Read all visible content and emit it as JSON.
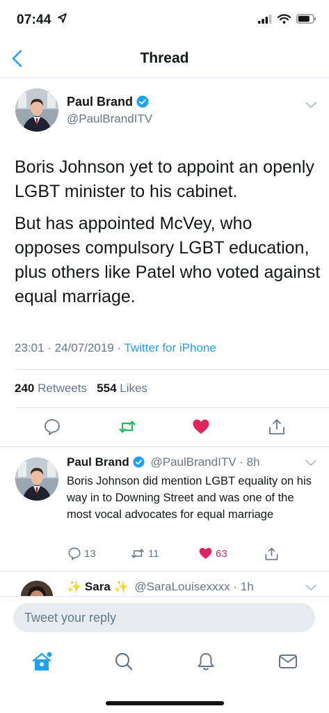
{
  "status_bar": {
    "time": "07:44"
  },
  "nav": {
    "title": "Thread"
  },
  "main_tweet": {
    "name": "Paul Brand",
    "handle": "@PaulBrandITV",
    "paragraphs": [
      "Boris Johnson yet to appoint an openly LGBT minister to his cabinet.",
      "But has appointed McVey, who opposes compulsory LGBT education, plus others like Patel who voted against equal marriage."
    ],
    "timestamp": "23:01 · 24/07/2019 · ",
    "source": "Twitter for iPhone",
    "retweets_count": "240",
    "retweets_label": "Retweets",
    "likes_count": "554",
    "likes_label": "Likes"
  },
  "reply_tweet": {
    "name": "Paul Brand",
    "handle_time": "@PaulBrandITV · 8h",
    "text": "Boris Johnson did mention LGBT equality on his way in to Downing Street and was one of the most vocal advocates for equal marriage",
    "reply_count": "13",
    "retweet_count": "11",
    "like_count": "63"
  },
  "next_tweet": {
    "sparkle_left": "✨",
    "name": "Sara",
    "sparkle_right": "✨",
    "handle_time": "@SaraLouisexxxx · 1h"
  },
  "composer": {
    "placeholder": "Tweet your reply"
  },
  "colors": {
    "accent": "#1da1f2",
    "retweet_green": "#17bf63",
    "like_red": "#e0245e",
    "secondary": "#657786"
  }
}
